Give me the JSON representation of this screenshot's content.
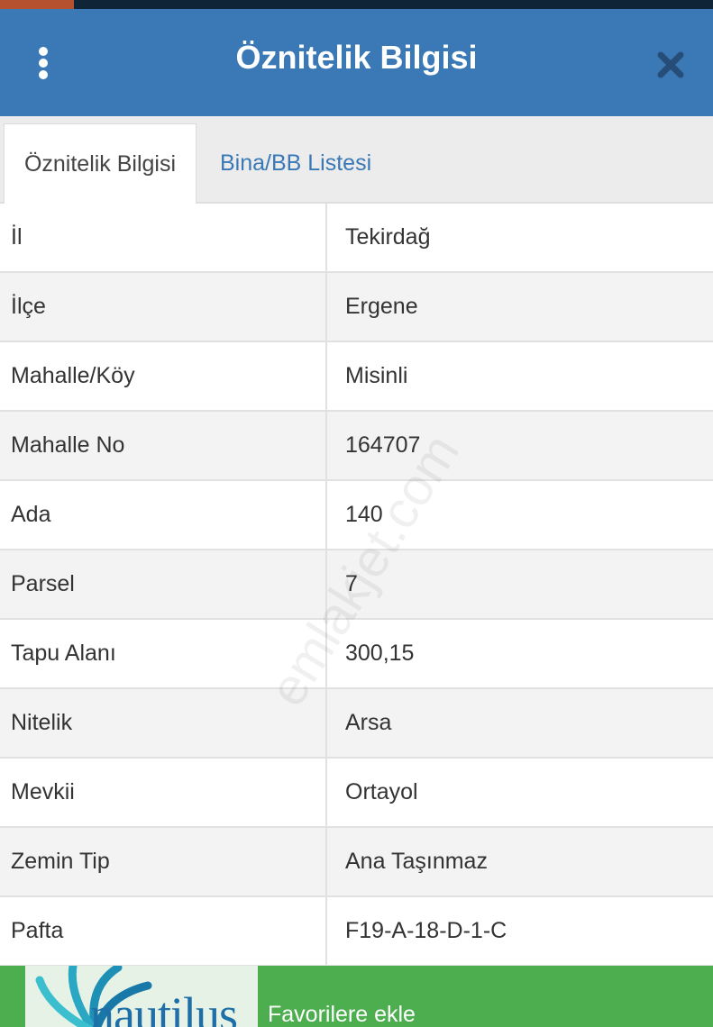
{
  "header": {
    "title": "Öznitelik Bilgisi",
    "background_color": "#3a78b6",
    "menu_icon": "vertical-dots-icon",
    "close_icon": "close-icon"
  },
  "tabs": [
    {
      "label": "Öznitelik Bilgisi",
      "active": true
    },
    {
      "label": "Bina/BB Listesi",
      "active": false
    }
  ],
  "attributes": [
    {
      "key": "İl",
      "value": "Tekirdağ"
    },
    {
      "key": "İlçe",
      "value": "Ergene"
    },
    {
      "key": "Mahalle/Köy",
      "value": "Misinli"
    },
    {
      "key": "Mahalle No",
      "value": "164707"
    },
    {
      "key": "Ada",
      "value": "140"
    },
    {
      "key": "Parsel",
      "value": "7"
    },
    {
      "key": "Tapu Alanı",
      "value": "300,15"
    },
    {
      "key": "Nitelik",
      "value": "Arsa"
    },
    {
      "key": "Mevkii",
      "value": "Ortayol"
    },
    {
      "key": "Zemin Tip",
      "value": "Ana Taşınmaz"
    },
    {
      "key": "Pafta",
      "value": "F19-A-18-D-1-C"
    }
  ],
  "watermark": "emlakjet.com",
  "ad": {
    "brand": "nautilus",
    "label": "Favorilere ekle",
    "background_color": "#4cae4f"
  }
}
